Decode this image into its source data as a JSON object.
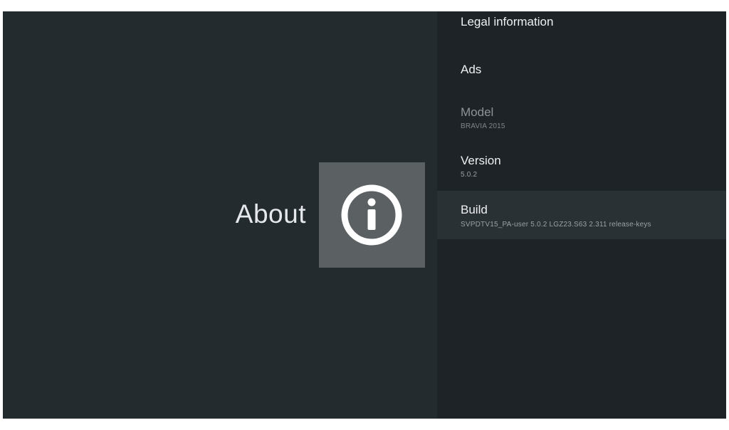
{
  "page": {
    "title": "About",
    "icon": "info-icon"
  },
  "menu": {
    "items": [
      {
        "id": "legal",
        "title": "Legal information",
        "subtitle": ""
      },
      {
        "id": "ads",
        "title": "Ads",
        "subtitle": ""
      },
      {
        "id": "model",
        "title": "Model",
        "subtitle": "BRAVIA 2015",
        "disabled": true
      },
      {
        "id": "version",
        "title": "Version",
        "subtitle": "5.0.2"
      },
      {
        "id": "build",
        "title": "Build",
        "subtitle": "SVPDTV15_PA-user 5.0.2 LGZ23.S63 2.311 release-keys",
        "focused": true
      }
    ]
  },
  "colors": {
    "background": "#1f2528",
    "left_pane": "#242b2f",
    "icon_tile": "#5b6063",
    "focused_row": "#2a3135"
  }
}
